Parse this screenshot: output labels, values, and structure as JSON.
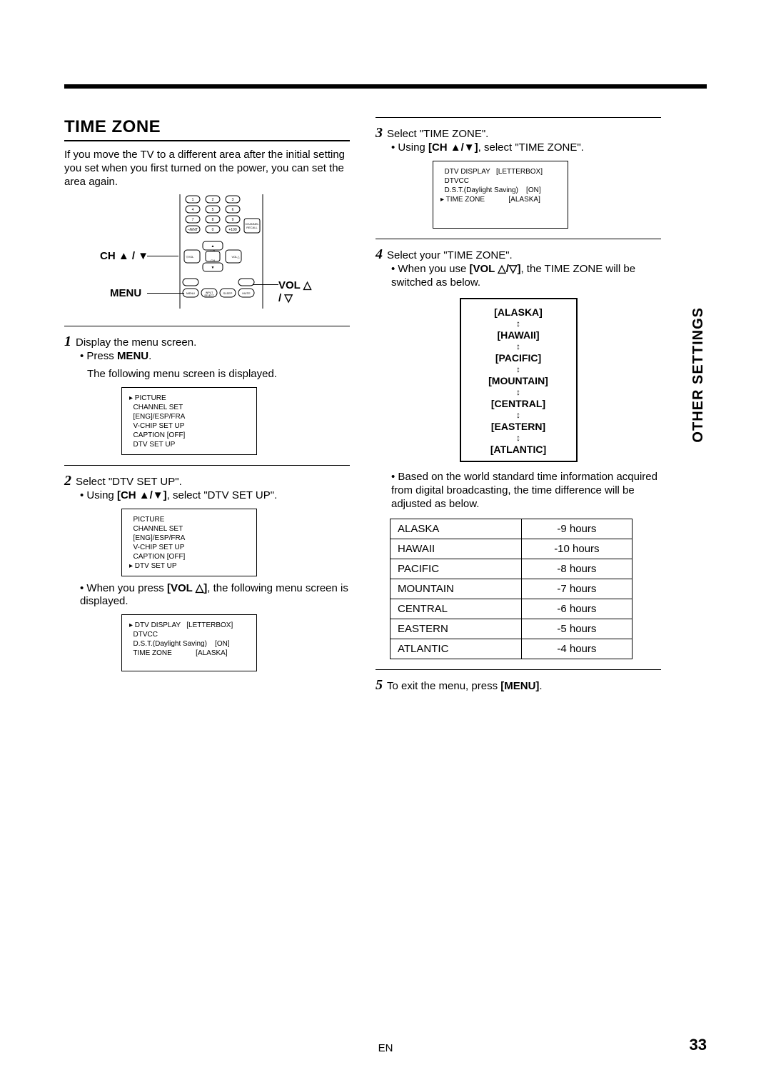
{
  "section": {
    "title": "TIME ZONE",
    "intro": "If you move the TV to a different area after the initial setting you set when you first turned on the power, you can set the area again."
  },
  "remote": {
    "ch_label": "CH ▲ / ▼",
    "menu_label": "MENU",
    "vol_label": "VOL △ / ▽"
  },
  "steps": {
    "s1": {
      "num": "1",
      "text": "Display the menu screen.",
      "bullet1": "Press ",
      "bold1": "MENU",
      "followup": "The following menu screen is displayed."
    },
    "s2": {
      "num": "2",
      "text": "Select \"DTV SET UP\".",
      "bullet1": "Using ",
      "bold1": "CH ▲/▼",
      "bullet1b": ", select \"DTV SET UP\".",
      "bullet2a": "When you press ",
      "bold2": "VOL △",
      "bullet2b": ", the following menu screen is displayed."
    },
    "s3": {
      "num": "3",
      "text": "Select \"TIME ZONE\".",
      "bullet1": "Using ",
      "bold1": "CH ▲/▼",
      "bullet1b": ", select \"TIME ZONE\"."
    },
    "s4": {
      "num": "4",
      "text": "Select your \"TIME ZONE\".",
      "bullet1a": "When you use ",
      "bold1": "VOL △/▽",
      "bullet1b": ", the TIME ZONE will be switched as below.",
      "bullet2": "Based on the world standard time information acquired from digital broadcasting, the time difference will be adjusted as below."
    },
    "s5": {
      "num": "5",
      "text": "To exit the menu, press ",
      "bold": "MENU",
      "tail": "."
    }
  },
  "menus": {
    "main": {
      "l1": "▸ PICTURE",
      "l2": "  CHANNEL SET",
      "l3": "  [ENG]/ESP/FRA",
      "l4": "  V-CHIP SET UP",
      "l5": "  CAPTION [OFF]",
      "l6": "  DTV SET UP"
    },
    "main2": {
      "l1": "  PICTURE",
      "l2": "  CHANNEL SET",
      "l3": "  [ENG]/ESP/FRA",
      "l4": "  V-CHIP SET UP",
      "l5": "  CAPTION [OFF]",
      "l6": "▸ DTV SET UP"
    },
    "dtv1": {
      "l1": "▸ DTV DISPLAY   [LETTERBOX]",
      "l2": "  DTVCC",
      "l3": "  D.S.T.(Daylight Saving)    [ON]",
      "l4": "  TIME ZONE            [ALASKA]"
    },
    "dtv2": {
      "l1": "  DTV DISPLAY   [LETTERBOX]",
      "l2": "  DTVCC",
      "l3": "  D.S.T.(Daylight Saving)    [ON]",
      "l4": "▸ TIME ZONE            [ALASKA]"
    }
  },
  "cycle": {
    "z1": "[ALASKA]",
    "z2": "[HAWAII]",
    "z3": "[PACIFIC]",
    "z4": "[MOUNTAIN]",
    "z5": "[CENTRAL]",
    "z6": "[EASTERN]",
    "z7": "[ATLANTIC]"
  },
  "offsets": [
    {
      "zone": "ALASKA",
      "diff": "-9 hours"
    },
    {
      "zone": "HAWAII",
      "diff": "-10 hours"
    },
    {
      "zone": "PACIFIC",
      "diff": "-8 hours"
    },
    {
      "zone": "MOUNTAIN",
      "diff": "-7 hours"
    },
    {
      "zone": "CENTRAL",
      "diff": "-6 hours"
    },
    {
      "zone": "EASTERN",
      "diff": "-5 hours"
    },
    {
      "zone": "ATLANTIC",
      "diff": "-4 hours"
    }
  ],
  "side_tab": "OTHER SETTINGS",
  "page_number": "33",
  "lang": "EN"
}
